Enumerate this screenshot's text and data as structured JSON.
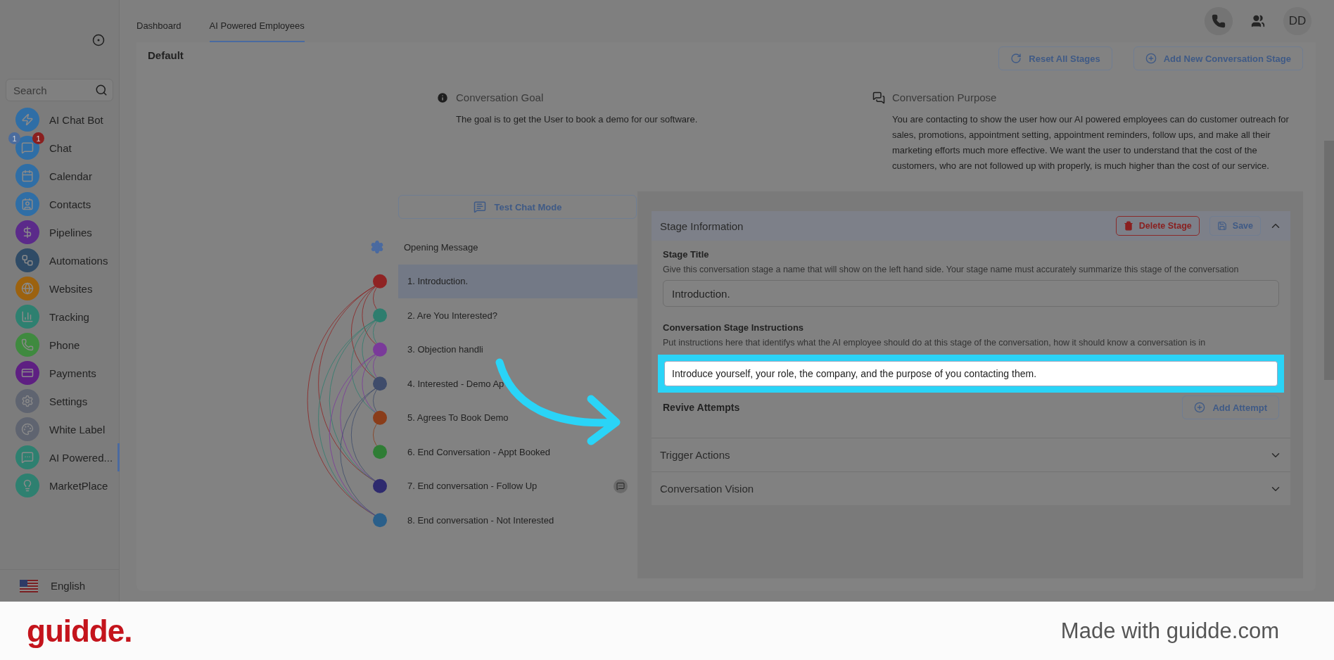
{
  "sidebar": {
    "search": {
      "placeholder": "Search"
    },
    "items": [
      {
        "label": "AI Chat Bot",
        "color": "#2f6ea6",
        "selected": false
      },
      {
        "label": "Chat",
        "color": "#2f6ea6",
        "selected": false,
        "badges": [
          {
            "text": "1",
            "kind": "count"
          },
          {
            "text": "1",
            "kind": "alert"
          }
        ]
      },
      {
        "label": "Calendar",
        "color": "#2f6ea6",
        "selected": false
      },
      {
        "label": "Contacts",
        "color": "#2f6ea6",
        "selected": false
      },
      {
        "label": "Pipelines",
        "color": "#5b2a8a",
        "selected": false
      },
      {
        "label": "Automations",
        "color": "#2f4b66",
        "selected": false
      },
      {
        "label": "Websites",
        "color": "#9c620f",
        "selected": false
      },
      {
        "label": "Tracking",
        "color": "#2e8070",
        "selected": false
      },
      {
        "label": "Phone",
        "color": "#3f8a3f",
        "selected": false
      },
      {
        "label": "Payments",
        "color": "#5e1f82",
        "selected": false
      },
      {
        "label": "Settings",
        "color": "#5f6470",
        "selected": false
      },
      {
        "label": "White Label",
        "color": "#5f6470",
        "selected": false
      },
      {
        "label": "AI Powered...",
        "color": "#2e8070",
        "selected": true
      },
      {
        "label": "MarketPlace",
        "color": "#2e8070",
        "selected": false
      }
    ],
    "language": "English"
  },
  "tabs": [
    {
      "label": "Dashboard",
      "selected": false
    },
    {
      "label": "AI Powered Employees",
      "selected": true
    }
  ],
  "header": {
    "avatar": "DD"
  },
  "page": {
    "title": "Default",
    "buttons": [
      {
        "label": "Reset All Stages",
        "kind": "reset"
      },
      {
        "label": "Add New Conversation Stage",
        "kind": "add"
      }
    ]
  },
  "goal": {
    "title": "Conversation Goal",
    "text": "The goal is to get the User to book a demo for our software."
  },
  "purpose": {
    "title": "Conversation Purpose",
    "text": "You are contacting to show the user how our AI powered employees can do customer outreach for sales, promotions, appointment setting, appointment reminders, follow ups, and make all their marketing efforts much more effective. We want the user to understand that the cost of the customers, who are not followed up with properly, is much higher than the cost of our service."
  },
  "test_chat_button": "Test Chat Mode",
  "opening_message": "Opening Message",
  "stages": [
    {
      "label": "1. Introduction.",
      "color": "#8f2323",
      "selected": true,
      "chat_icon": false
    },
    {
      "label": "2. Are You Interested?",
      "color": "#2e7d6e",
      "selected": false,
      "chat_icon": false
    },
    {
      "label": "3. Objection handli",
      "color": "#7a3a9a",
      "selected": false,
      "chat_icon": false
    },
    {
      "label": "4. Interested - Demo Ap",
      "color": "#3f4c6b",
      "selected": false,
      "chat_icon": false
    },
    {
      "label": "5. Agrees To Book Demo",
      "color": "#8a3d1a",
      "selected": false,
      "chat_icon": false
    },
    {
      "label": "6. End Conversation - Appt Booked",
      "color": "#2f7d35",
      "selected": false,
      "chat_icon": false
    },
    {
      "label": "7. End conversation - Follow Up",
      "color": "#2e2a6e",
      "selected": false,
      "chat_icon": true
    },
    {
      "label": "8. End conversation - Not Interested",
      "color": "#2a5f8a",
      "selected": false,
      "chat_icon": false
    }
  ],
  "stage_panel": {
    "title": "Stage Information",
    "expanded": true,
    "delete_button": "Delete Stage",
    "save_button": "Save",
    "stage_title": {
      "label": "Stage Title",
      "help": "Give this conversation stage a name that will show on the left hand side. Your stage name must accurately summarize this stage of the conversation",
      "value": "Introduction."
    },
    "instructions": {
      "label": "Conversation Stage Instructions",
      "help": "Put instructions here that identifys what the AI employee should do at this stage of the conversation, how it should know a conversation is in",
      "value": "Introduce yourself, your role, the company, and the purpose of you contacting them."
    },
    "revive": {
      "label": "Revive Attempts",
      "button": "Add Attempt"
    },
    "sections": [
      {
        "title": "Trigger Actions",
        "expanded": false
      },
      {
        "title": "Conversation Vision",
        "expanded": false
      }
    ]
  },
  "footer": {
    "logo": "guidde.",
    "tagline": "Made with guidde.com"
  }
}
